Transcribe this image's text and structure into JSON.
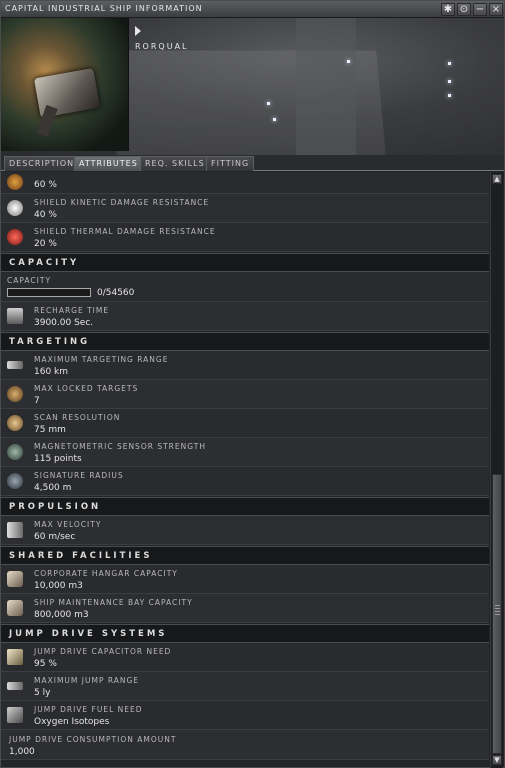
{
  "window": {
    "title": "CAPITAL INDUSTRIAL SHIP INFORMATION",
    "buttons": [
      "✱",
      "⊙",
      "−",
      "×"
    ]
  },
  "ship": {
    "name": "RORQUAL"
  },
  "tabs": [
    {
      "label": "DESCRIPTION",
      "active": false
    },
    {
      "label": "ATTRIBUTES",
      "active": true
    },
    {
      "label": "REQ. SKILLS",
      "active": false
    },
    {
      "label": "FITTING",
      "active": false
    }
  ],
  "rows": {
    "em": {
      "value": "60 %"
    },
    "kinetic": {
      "label": "SHIELD KINETIC DAMAGE RESISTANCE",
      "value": "40 %"
    },
    "thermal": {
      "label": "SHIELD THERMAL DAMAGE RESISTANCE",
      "value": "20 %"
    },
    "capacity_section": "CAPACITY",
    "capacity": {
      "label": "CAPACITY",
      "value": "0/54560",
      "fill": 0
    },
    "recharge": {
      "label": "RECHARGE TIME",
      "value": "3900.00 Sec."
    },
    "targeting_section": "TARGETING",
    "max_range": {
      "label": "MAXIMUM TARGETING RANGE",
      "value": "160 km"
    },
    "locked": {
      "label": "MAX LOCKED TARGETS",
      "value": "7"
    },
    "scanres": {
      "label": "SCAN RESOLUTION",
      "value": "75 mm"
    },
    "magnet": {
      "label": "MAGNETOMETRIC SENSOR STRENGTH",
      "value": "115 points"
    },
    "sig": {
      "label": "SIGNATURE RADIUS",
      "value": "4,500 m"
    },
    "propulsion_section": "PROPULSION",
    "velocity": {
      "label": "MAX VELOCITY",
      "value": "60 m/sec"
    },
    "shared_section": "SHARED FACILITIES",
    "corp_hangar": {
      "label": "CORPORATE HANGAR CAPACITY",
      "value": "10,000 m3"
    },
    "smb": {
      "label": "SHIP MAINTENANCE BAY CAPACITY",
      "value": "800,000 m3"
    },
    "jump_section": "JUMP DRIVE SYSTEMS",
    "jd_cap": {
      "label": "JUMP DRIVE CAPACITOR NEED",
      "value": "95 %"
    },
    "jd_range": {
      "label": "MAXIMUM JUMP RANGE",
      "value": "5 ly"
    },
    "jd_fuel": {
      "label": "JUMP DRIVE FUEL NEED",
      "value": "Oxygen Isotopes"
    },
    "jd_consumption": {
      "label": "JUMP DRIVE CONSUMPTION AMOUNT",
      "value": "1,000"
    }
  },
  "scrollbar": {
    "up": "▲",
    "down": "▼"
  },
  "colors": {
    "accent": "#6e7074",
    "section_bg": "#17181a",
    "thermal_icon": "#c8302a"
  }
}
